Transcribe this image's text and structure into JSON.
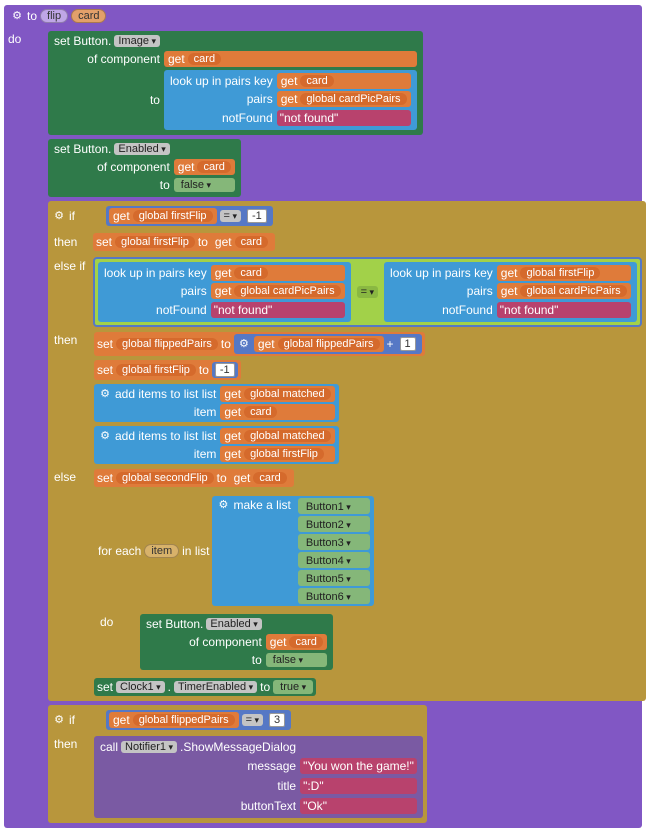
{
  "proc": {
    "kw_to": "to",
    "name": "flip",
    "param": "card"
  },
  "words": {
    "do": "do",
    "then": "then",
    "else_if": "else if",
    "else": "else",
    "if": "if",
    "set_button": "set Button.",
    "of_component": "of component",
    "to": "to",
    "lookup": "look up in pairs  key",
    "pairs": "pairs",
    "notFound": "notFound",
    "get": "get",
    "set": "set",
    "call": "call",
    "for_each": "for each",
    "item": "item",
    "in_list": "in list",
    "make_a_list": "make a list",
    "add_items_list": "add items to list   list",
    "add_items_item": "item",
    "show_dialog": ".ShowMessageDialog",
    "message": "message",
    "title": "title",
    "buttonText": "buttonText"
  },
  "dropdowns": {
    "Image": "Image",
    "Enabled": "Enabled",
    "TimerEnabled": "TimerEnabled",
    "Clock1": "Clock1",
    "Notifier1": "Notifier1",
    "eq": "="
  },
  "vars": {
    "card": "card",
    "firstFlip": "global firstFlip",
    "secondFlip": "global secondFlip",
    "cardPicPairs": "global cardPicPairs",
    "flippedPairs": "global flippedPairs",
    "matched": "global matched",
    "item": "item"
  },
  "literals": {
    "not_found": "not found",
    "false": "false",
    "true": "true",
    "neg1": "-1",
    "one": "1",
    "three": "3",
    "won": "You won the game!",
    "smile": ":D",
    "ok": "Ok"
  },
  "buttons": [
    "Button1",
    "Button2",
    "Button3",
    "Button4",
    "Button5",
    "Button6"
  ]
}
